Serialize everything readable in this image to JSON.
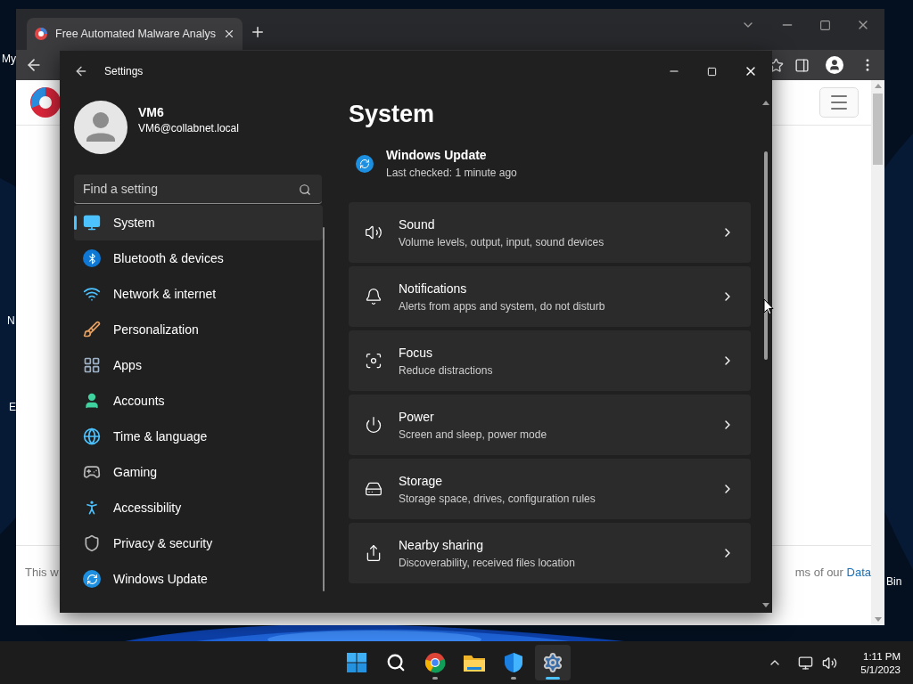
{
  "desktop": {
    "icon_labels": [
      "My",
      "N",
      "E",
      "Bin"
    ]
  },
  "browser": {
    "tabs": [
      {
        "title": "Free Automated Malware Analys",
        "selected": true
      }
    ],
    "page": {
      "footer_left": "This w",
      "footer_right": "ms of our ",
      "footer_link": "Data"
    }
  },
  "settings": {
    "title": "Settings",
    "user": {
      "name": "VM6",
      "email": "VM6@collabnet.local"
    },
    "search": {
      "placeholder": "Find a setting"
    },
    "nav": [
      {
        "label": "System",
        "selected": true
      },
      {
        "label": "Bluetooth & devices",
        "selected": false
      },
      {
        "label": "Network & internet",
        "selected": false
      },
      {
        "label": "Personalization",
        "selected": false
      },
      {
        "label": "Apps",
        "selected": false
      },
      {
        "label": "Accounts",
        "selected": false
      },
      {
        "label": "Time & language",
        "selected": false
      },
      {
        "label": "Gaming",
        "selected": false
      },
      {
        "label": "Accessibility",
        "selected": false
      },
      {
        "label": "Privacy & security",
        "selected": false
      },
      {
        "label": "Windows Update",
        "selected": false
      }
    ],
    "heading": "System",
    "update": {
      "title": "Windows Update",
      "subtitle": "Last checked: 1 minute ago"
    },
    "cards": [
      {
        "title": "Sound",
        "subtitle": "Volume levels, output, input, sound devices"
      },
      {
        "title": "Notifications",
        "subtitle": "Alerts from apps and system, do not disturb"
      },
      {
        "title": "Focus",
        "subtitle": "Reduce distractions"
      },
      {
        "title": "Power",
        "subtitle": "Screen and sleep, power mode"
      },
      {
        "title": "Storage",
        "subtitle": "Storage space, drives, configuration rules"
      },
      {
        "title": "Nearby sharing",
        "subtitle": "Discoverability, received files location"
      }
    ]
  },
  "taskbar": {
    "apps": [
      {
        "kind": "start",
        "running": false,
        "selected": false
      },
      {
        "kind": "search",
        "running": false,
        "selected": false
      },
      {
        "kind": "browser",
        "running": true,
        "selected": false
      },
      {
        "kind": "files",
        "running": false,
        "selected": false
      },
      {
        "kind": "security",
        "running": true,
        "selected": false
      },
      {
        "kind": "settings",
        "running": true,
        "selected": true
      }
    ],
    "time": "1:11 PM",
    "date": "5/1/2023"
  }
}
